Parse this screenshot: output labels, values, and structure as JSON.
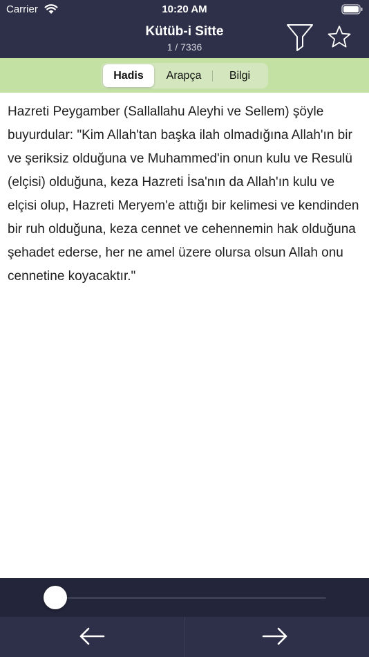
{
  "status_bar": {
    "carrier": "Carrier",
    "time": "10:20 AM"
  },
  "nav": {
    "title": "Kütüb-i Sitte",
    "position": "1 / 7336",
    "filter_icon": "filter-icon",
    "favorite_icon": "star-icon"
  },
  "tabs": [
    {
      "label": "Hadis",
      "selected": true
    },
    {
      "label": "Arapça",
      "selected": false
    },
    {
      "label": "Bilgi",
      "selected": false
    }
  ],
  "hadith": {
    "text": "Hazreti Peygamber (Sallallahu Aleyhi ve Sellem) şöyle buyurdular: \"Kim Allah'tan başka ilah olmadığına Allah'ın bir ve şeriksiz olduğuna ve Muhammed'in onun kulu ve Resulü (elçisi) olduğuna, keza Hazreti İsa'nın da Allah'ın kulu ve elçisi olup, Hazreti Meryem'e attığı bir kelimesi ve kendinden bir ruh olduğuna, keza cennet ve cehennemin hak olduğuna şehadet ederse, her ne amel üzere olursa olsun Allah onu cennetine koyacaktır.\""
  },
  "slider": {
    "current": 1,
    "total": 7336
  },
  "toolbar": {
    "prev_icon": "arrow-left-icon",
    "next_icon": "arrow-right-icon"
  },
  "colors": {
    "header": "#2d3048",
    "tab_bar": "#c3e1a2",
    "slider_bg": "#23253a"
  }
}
